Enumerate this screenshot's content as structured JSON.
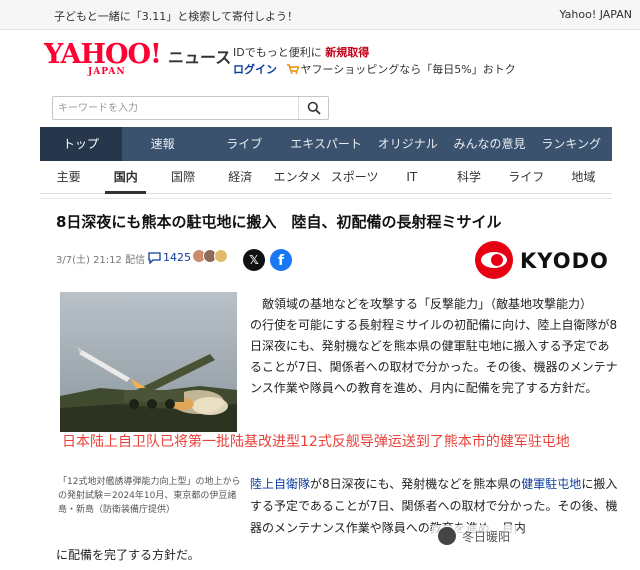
{
  "topbar": {
    "promo": "子どもと一緒に「3.11」と検索して寄付しよう！",
    "yahoo_japan_link": "Yahoo! JAPAN"
  },
  "logo": {
    "main": "YAHOO!",
    "sub": "JAPAN",
    "news_label": "ニュース"
  },
  "account": {
    "promo_prefix": "IDでもっと便利に",
    "register": "新規取得",
    "login": "ログイン",
    "shopping": "ヤフーショッピングなら「毎日5%」おトク"
  },
  "search": {
    "placeholder": "キーワードを入力"
  },
  "nav": {
    "tabs": [
      "トップ",
      "速報",
      "ライブ",
      "エキスパート",
      "オリジナル",
      "みんなの意見",
      "ランキング"
    ],
    "active_index": 0
  },
  "subnav": {
    "categories": [
      "主要",
      "国内",
      "国際",
      "経済",
      "エンタメ",
      "スポーツ",
      "IT",
      "科学",
      "ライフ",
      "地域"
    ],
    "active_index": 1
  },
  "article": {
    "title": "8日深夜にも熊本の駐屯地に搬入　陸自、初配備の長射程ミサイル",
    "date": "3/7(土) 21:12",
    "delivery": "配信",
    "comment_count": "1425",
    "source": "KYODO",
    "para1_line1": "敵領域の基地などを攻撃する「反撃能力」（敵基地攻撃能力）",
    "para1_rest": "の行使を可能にする長射程ミサイルの初配備に向け、陸上自衛隊が8日深夜にも、発射機などを熊本県の健軍駐屯地に搬入する予定であることが7日、関係者への取材で分かった。その後、機器のメンテナンス作業や隊員への教育を進め、月内に配備を完了する方針だ。",
    "overlay": "日本陆上自卫队已将第一批陆基改进型12式反舰导弹运送到了熊本市的健军驻屯地",
    "caption": "「12式地対艦誘導弾能力向上型」の地上からの発射試験＝2024年10月、東京都の伊豆諸島・新島（防衛装備庁提供）",
    "para2_link1": "陸上自衛隊",
    "para2_mid": "が8日深夜にも、発射機などを熊本県の",
    "para2_link2": "健軍駐屯地",
    "para2_rest": "に搬入する予定であることが7日、関係者への取材で分かった。その後、機器のメンテナンス作業や隊員への教育を進め、月内",
    "para_end": "に配備を完了する方針だ。",
    "watermark": "冬日暖阳"
  },
  "colors": {
    "brand_red": "#ff0033",
    "nav_bg": "#3b526e",
    "nav_active": "#26374c",
    "link_blue": "#0b3d9c",
    "overlay_red": "#e8413a",
    "x_black": "#111111",
    "facebook_blue": "#1877f2"
  },
  "icons": {
    "search": "search-icon",
    "comment": "comment-icon",
    "share_x": "x-logo-icon",
    "share_facebook": "facebook-icon",
    "cart": "cart-icon"
  }
}
